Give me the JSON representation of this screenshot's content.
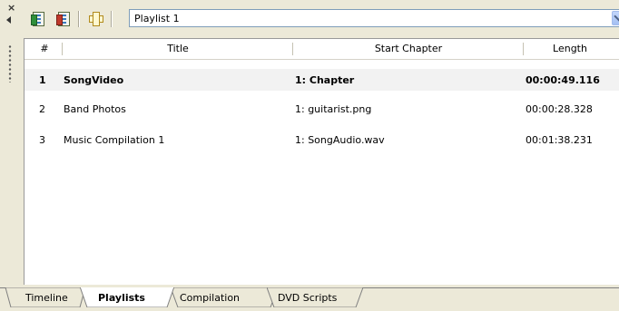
{
  "playlist_select": {
    "value": "Playlist 1"
  },
  "table": {
    "columns": [
      "#",
      "Title",
      "Start Chapter",
      "Length"
    ],
    "rows": [
      {
        "num": "1",
        "title": "SongVideo",
        "start": "1: Chapter",
        "length": "00:00:49.116",
        "bold": true
      },
      {
        "num": "2",
        "title": "Band Photos",
        "start": "1: guitarist.png",
        "length": "00:00:28.328"
      },
      {
        "num": "3",
        "title": "Music Compilation 1",
        "start": "1: SongAudio.wav",
        "length": "00:01:38.231"
      }
    ]
  },
  "tabs": [
    {
      "label": "Timeline",
      "active": false
    },
    {
      "label": "Playlists",
      "active": true
    },
    {
      "label": "Compilation",
      "active": false
    },
    {
      "label": "DVD Scripts",
      "active": false
    }
  ],
  "icons": {
    "close": "close-icon",
    "collapse": "collapse-arrow-icon",
    "grip": "grip-handle-icon",
    "new_playlist": "new-playlist-icon",
    "delete_playlist": "delete-playlist-icon",
    "add": "add-icon",
    "dropdown": "chevron-down-icon"
  },
  "colors": {
    "panel_bg": "#ece9d8",
    "selected_row_bg": "#f2f2f2",
    "select_border": "#7f9db9"
  }
}
